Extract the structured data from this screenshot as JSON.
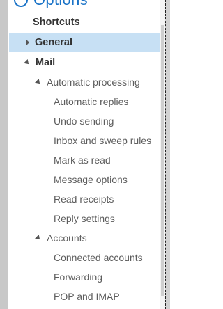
{
  "header": {
    "title": "Options"
  },
  "nav": {
    "shortcuts": "Shortcuts",
    "general": "General",
    "mail": "Mail",
    "automatic_processing": "Automatic processing",
    "automatic_items": [
      "Automatic replies",
      "Undo sending",
      "Inbox and sweep rules",
      "Mark as read",
      "Message options",
      "Read receipts",
      "Reply settings"
    ],
    "accounts": "Accounts",
    "account_items": [
      "Connected accounts",
      "Forwarding",
      "POP and IMAP"
    ]
  },
  "colors": {
    "accent": "#1a73c7",
    "selected_bg": "#c7e0f4"
  }
}
